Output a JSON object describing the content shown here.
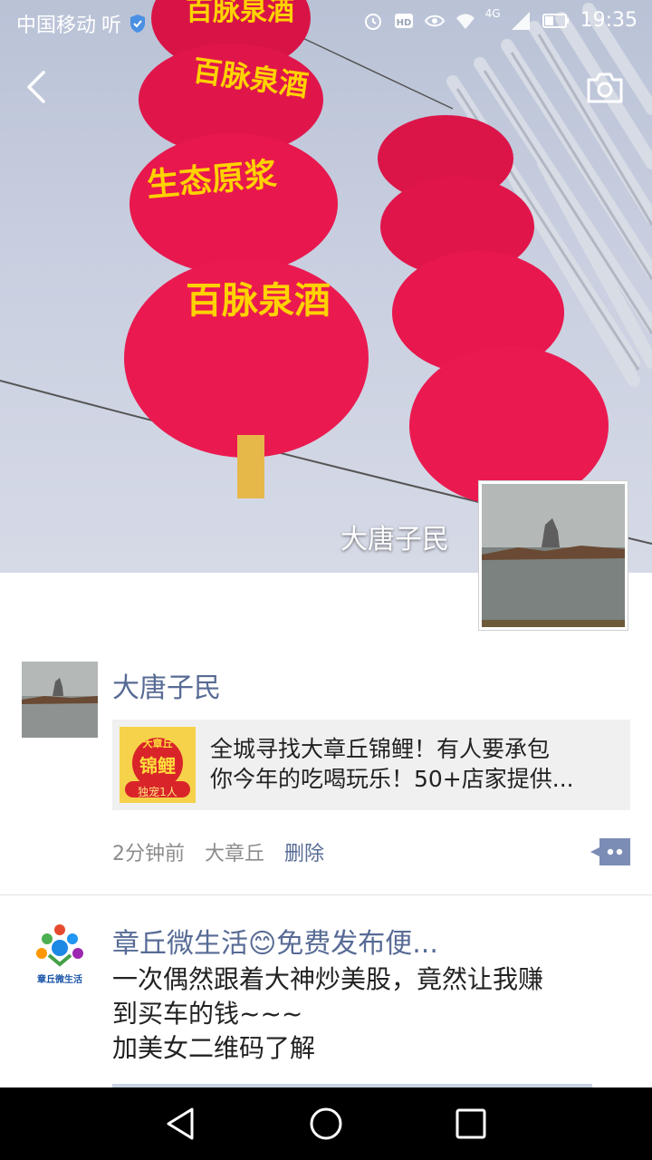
{
  "status_bar": {
    "carrier": "中国移动",
    "carrier_extra": "听",
    "network": "4G",
    "time": "19:35",
    "icons": [
      "shield-icon",
      "alarm-icon",
      "hd-icon",
      "eye-icon",
      "wifi-icon",
      "signal-icon",
      "battery-icon"
    ]
  },
  "cover": {
    "lantern_texts": [
      "百脉泉酒",
      "百脉泉酒",
      "生态原浆",
      "百脉泉酒"
    ],
    "profile_name": "大唐子民"
  },
  "posts": [
    {
      "author": "大唐子民",
      "share": {
        "thumb_top": "大章丘",
        "thumb_main": "锦鲤",
        "thumb_bottom": "独宠1人",
        "line1": "全城寻找大章丘锦鲤！有人要承包",
        "line2": "你今年的吃喝玩乐！50+店家提供..."
      },
      "time": "2分钟前",
      "location": "大章丘",
      "delete_label": "删除"
    },
    {
      "author": "章丘微生活😊免费发布便...",
      "avatar_label": "章丘微生活",
      "lines": [
        "一次偶然跟着大神炒美股，竟然让我赚",
        "到买车的钱~~~",
        "加美女二维码了解"
      ]
    }
  ],
  "colors": {
    "link": "#576b95",
    "lantern": "#e8174d",
    "lantern_text": "#ffd200"
  }
}
